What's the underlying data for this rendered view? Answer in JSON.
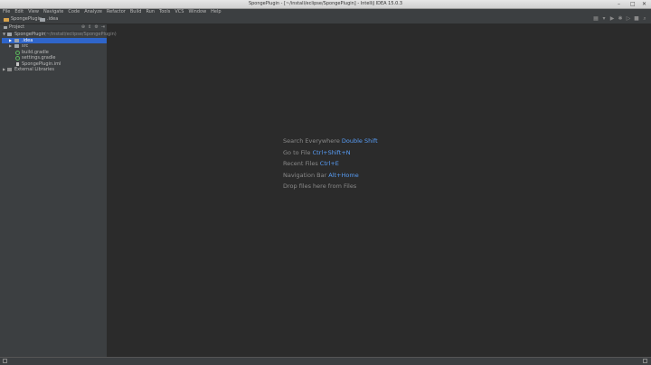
{
  "window": {
    "title": "SpongePlugin - [~/install/eclipse/SpongePlugin] - IntelliJ IDEA 15.0.3",
    "controls": [
      "–",
      "□",
      "✕"
    ]
  },
  "menu": [
    "File",
    "Edit",
    "View",
    "Navigate",
    "Code",
    "Analyze",
    "Refactor",
    "Build",
    "Run",
    "Tools",
    "VCS",
    "Window",
    "Help"
  ],
  "navbar": {
    "crumbs": [
      "SpongePlugin",
      ".idea"
    ],
    "icons": [
      "build-icon",
      "dropdown-icon",
      "run-icon",
      "debug-icon",
      "coverage-icon",
      "stop-icon",
      "search-icon"
    ]
  },
  "project_panel": {
    "title": "Project",
    "tree": [
      {
        "label": "SpongePlugin",
        "detail": "(~/install/eclipse/SpongePlugin)",
        "depth": 0,
        "expanded": true,
        "icon": "folder-icon"
      },
      {
        "label": ".idea",
        "depth": 1,
        "expanded": false,
        "selected": true,
        "icon": "folder-icon"
      },
      {
        "label": "src",
        "depth": 1,
        "expanded": false,
        "icon": "folder-icon"
      },
      {
        "label": "build.gradle",
        "depth": 1,
        "icon": "gradle-icon"
      },
      {
        "label": "settings.gradle",
        "depth": 1,
        "icon": "gradle-icon"
      },
      {
        "label": "SpongePlugin.iml",
        "depth": 1,
        "icon": "file-icon"
      },
      {
        "label": "External Libraries",
        "depth": 0,
        "expanded": false,
        "icon": "library-icon"
      }
    ]
  },
  "editor_hints": [
    {
      "text": "Search Everywhere",
      "shortcut": "Double Shift"
    },
    {
      "text": "Go to File",
      "shortcut": "Ctrl+Shift+N"
    },
    {
      "text": "Recent Files",
      "shortcut": "Ctrl+E"
    },
    {
      "text": "Navigation Bar",
      "shortcut": "Alt+Home"
    },
    {
      "text": "Drop files here from Files",
      "shortcut": ""
    }
  ],
  "colors": {
    "accent": "#2f65ca",
    "shortcut": "#589df6",
    "background": "#2b2b2b",
    "panel": "#3c3f41"
  }
}
